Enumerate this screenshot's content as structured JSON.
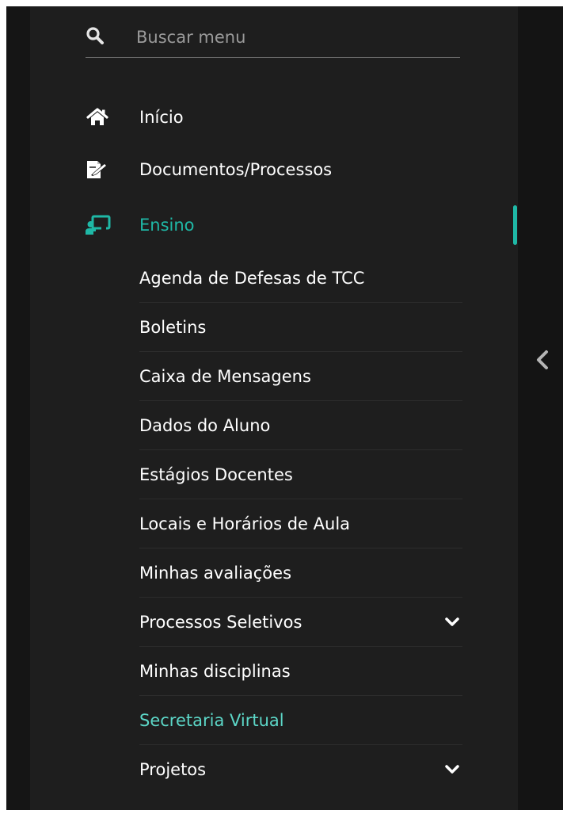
{
  "search": {
    "placeholder": "Buscar menu",
    "icon": "search-icon"
  },
  "menu": {
    "top_items": [
      {
        "label": "Início",
        "icon": "home-icon"
      },
      {
        "label": "Documentos/Processos",
        "icon": "document-edit-icon"
      },
      {
        "label": "Ensino",
        "icon": "chalkboard-teacher-icon",
        "active": true
      }
    ],
    "ensino_items": [
      {
        "label": "Agenda de Defesas de TCC"
      },
      {
        "label": "Boletins"
      },
      {
        "label": "Caixa de Mensagens"
      },
      {
        "label": "Dados do Aluno"
      },
      {
        "label": "Estágios Docentes"
      },
      {
        "label": "Locais e Horários de Aula"
      },
      {
        "label": "Minhas avaliações"
      },
      {
        "label": "Processos Seletivos",
        "expandable": true
      },
      {
        "label": "Minhas disciplinas"
      },
      {
        "label": "Secretaria Virtual",
        "highlighted": true
      },
      {
        "label": "Projetos",
        "expandable": true
      }
    ]
  },
  "collapse_toggle": {
    "icon": "chevron-left-icon"
  },
  "colors": {
    "sidebar_bg": "#1e1e1e",
    "accent": "#1fb8a6",
    "highlight_text": "#5cd6c7",
    "text": "#ffffff",
    "muted_text": "#9a9a9a"
  }
}
